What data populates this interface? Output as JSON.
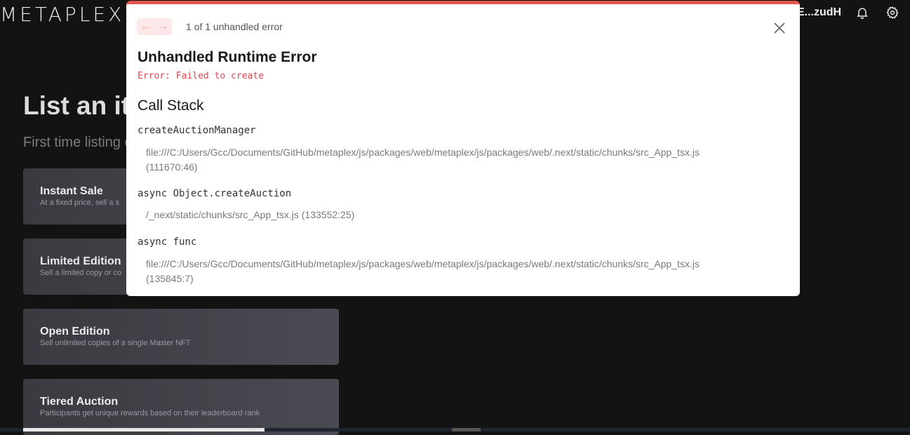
{
  "header": {
    "logo": "METAPLEX",
    "wallet": "E...zudH",
    "icons": [
      "bell-icon",
      "gear-icon"
    ]
  },
  "page": {
    "title": "List an ite",
    "subtitle": "First time listing o"
  },
  "options": [
    {
      "title": "Instant Sale",
      "description": "At a fixed price, sell a s"
    },
    {
      "title": "Limited Edition",
      "description": "Sell a limited copy or co"
    },
    {
      "title": "Open Edition",
      "description": "Sell unlimited copies of a single Master NFT"
    },
    {
      "title": "Tiered Auction",
      "description": "Participants get unique rewards based on their leaderboard rank"
    }
  ],
  "error_overlay": {
    "count_text": "1 of 1 unhandled error",
    "title": "Unhandled Runtime Error",
    "message": "Error: Failed to create",
    "call_stack_title": "Call Stack",
    "frames": [
      {
        "function": "createAuctionManager",
        "location": "file:///C:/Users/Gcc/Documents/GitHub/metaplex/js/packages/web/metaplex/js/packages/web/.next/static/chunks/src_App_tsx.js",
        "position": "(111670:46)"
      },
      {
        "function": "async Object.createAuction",
        "location": "/_next/static/chunks/src_App_tsx.js",
        "position": "(133552:25)"
      },
      {
        "function": "async func",
        "location": "file:///C:/Users/Gcc/Documents/GitHub/metaplex/js/packages/web/metaplex/js/packages/web/.next/static/chunks/src_App_tsx.js",
        "position": "(135845:7)"
      }
    ],
    "accent_color": "#e0574f"
  }
}
